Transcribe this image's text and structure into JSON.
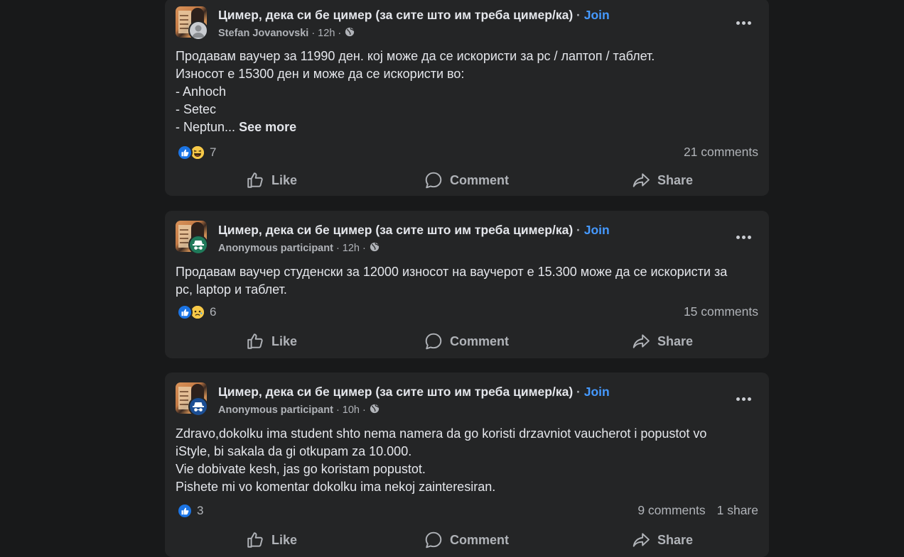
{
  "posts": [
    {
      "group_title": "Цимер, дека си бе цимер (за сите што им треба цимер/ка)",
      "separator": "·",
      "join_label": "Join",
      "author": "Stefan Jovanovski",
      "time": "· 12h ·",
      "user_avatar_icon": "default-profile-icon",
      "lines": [
        "Продавам ваучер за 11990 ден. кој може да се искористи за pc / лаптоп / таблет.",
        "Износот е 15300 ден и може да се искористи во:",
        "- Anhoch",
        "- Setec",
        "- Neptun..."
      ],
      "see_more": "See more",
      "reactions": [
        "like",
        "haha"
      ],
      "reaction_count": "7",
      "comments": "21 comments",
      "shares": "",
      "actions": {
        "like": "Like",
        "comment": "Comment",
        "share": "Share"
      }
    },
    {
      "group_title": "Цимер, дека си бе цимер (за сите што им треба цимер/ка)",
      "separator": "·",
      "join_label": "Join",
      "author": "Anonymous participant",
      "time": "· 12h ·",
      "user_avatar_icon": "anonymous-icon",
      "lines": [
        "Продавам ваучер студенски за 12000 износот на ваучерот е 15.300 може да се искористи за",
        "pc, laptop и таблет."
      ],
      "see_more": "",
      "reactions": [
        "like",
        "sad"
      ],
      "reaction_count": "6",
      "comments": "15 comments",
      "shares": "",
      "actions": {
        "like": "Like",
        "comment": "Comment",
        "share": "Share"
      }
    },
    {
      "group_title": "Цимер, дека си бе цимер (за сите што им треба цимер/ка)",
      "separator": "·",
      "join_label": "Join",
      "author": "Anonymous participant",
      "time": "· 10h ·",
      "user_avatar_icon": "anonymous-icon",
      "lines": [
        "Zdravo,dokolku ima student shto nema namera da go koristi drzavniot vaucherot i popustot vo",
        "iStyle, bi sakala da gi otkupam za 10.000.",
        "Vie dobivate kesh, jas go koristam popustot.",
        "Pishete mi vo komentar dokolku ima nekoj zainteresiran."
      ],
      "see_more": "",
      "reactions": [
        "like"
      ],
      "reaction_count": "3",
      "comments": "9 comments",
      "shares": "1 share",
      "actions": {
        "like": "Like",
        "comment": "Comment",
        "share": "Share"
      }
    }
  ],
  "colors": {
    "page_bg": "#18191a",
    "card_bg": "#242526",
    "join": "#4599ff",
    "secondary_text": "#b0b3b8",
    "like_blue": "#1b74e4",
    "anon_green": "#1f7a5a",
    "anon_blue": "#1b4e94"
  }
}
